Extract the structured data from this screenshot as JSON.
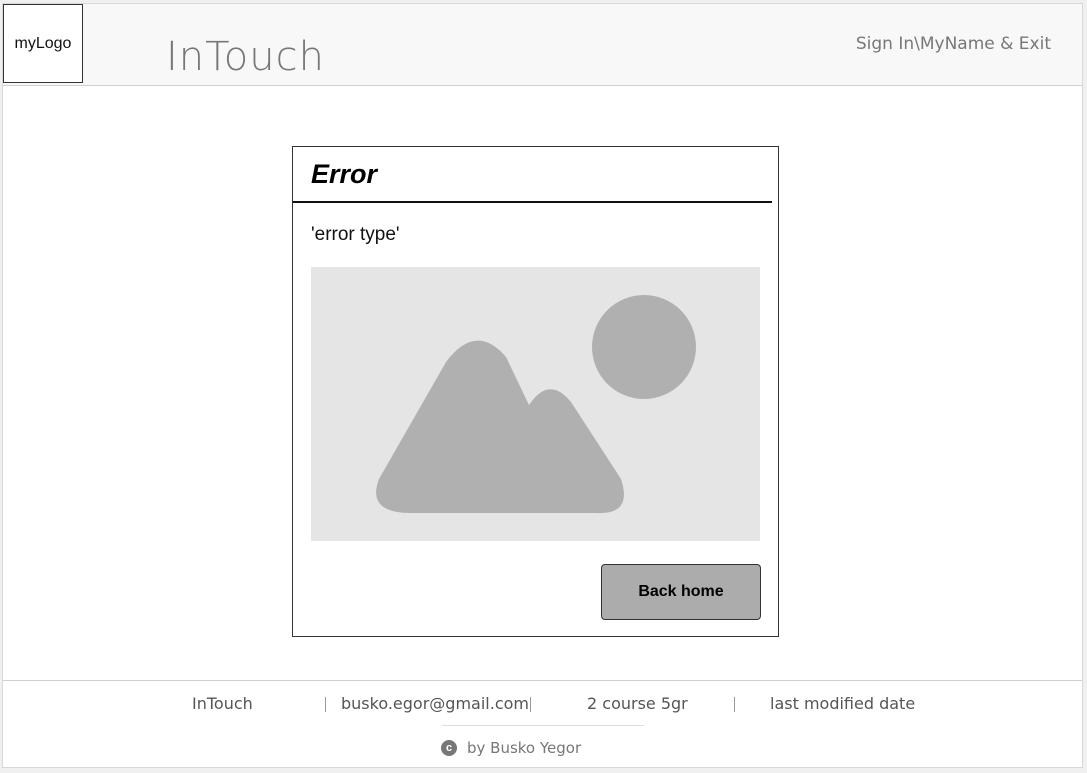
{
  "header": {
    "logo_text": "myLogo",
    "app_title": "InTouch",
    "auth_link": "Sign In\\MyName & Exit"
  },
  "error_card": {
    "title": "Error",
    "subtitle": "'error type'",
    "image_icon": "image-placeholder-icon",
    "back_button_label": "Back home"
  },
  "footer": {
    "items": [
      "InTouch",
      "busko.egor@gmail.com",
      "2 course 5gr",
      "last modified date"
    ],
    "copyright_icon": "copyright-icon",
    "copyright_text": "by Busko Yegor"
  },
  "colors": {
    "header_bg": "#f8f8f8",
    "placeholder_bg": "#e5e5e5",
    "placeholder_shape": "#b0b0b0",
    "button_bg": "#acacac"
  }
}
